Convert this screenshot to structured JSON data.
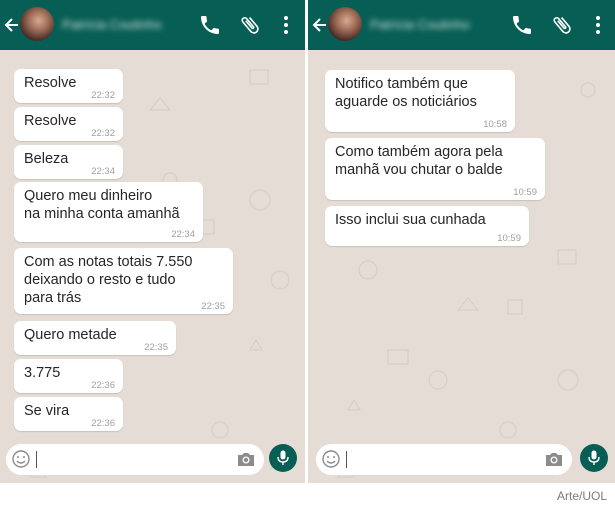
{
  "colors": {
    "header": "#075e54",
    "chat_background": "#e5ddd5",
    "bubble": "#ffffff",
    "mic_button": "#075e54"
  },
  "left_chat": {
    "contact_name": "Patrícia Coutinho",
    "messages": [
      {
        "text": "Resolve",
        "time": "22:32"
      },
      {
        "text": "Resolve",
        "time": "22:32"
      },
      {
        "text": "Beleza",
        "time": "22:34"
      },
      {
        "text": "Quero meu dinheiro\nna minha conta amanhã",
        "time": "22:34"
      },
      {
        "text": "Com as notas totais 7.550\ndeixando o resto e tudo\npara trás",
        "time": "22:35"
      },
      {
        "text": "Quero metade",
        "time": "22:35"
      },
      {
        "text": "3.775",
        "time": "22:36"
      },
      {
        "text": "Se vira",
        "time": "22:36"
      }
    ]
  },
  "right_chat": {
    "contact_name": "Patrícia Coutinho",
    "messages": [
      {
        "text": "Notifico também que\naguarde os noticiários",
        "time": "10:58"
      },
      {
        "text": "Como também agora pela\nmanhã vou chutar o balde",
        "time": "10:59"
      },
      {
        "text": "Isso inclui sua cunhada",
        "time": "10:59"
      }
    ]
  },
  "icons": [
    "back-arrow-icon",
    "phone-icon",
    "attachment-icon",
    "more-options-icon",
    "smiley-icon",
    "camera-icon",
    "mic-icon"
  ],
  "credit": "Arte/UOL"
}
